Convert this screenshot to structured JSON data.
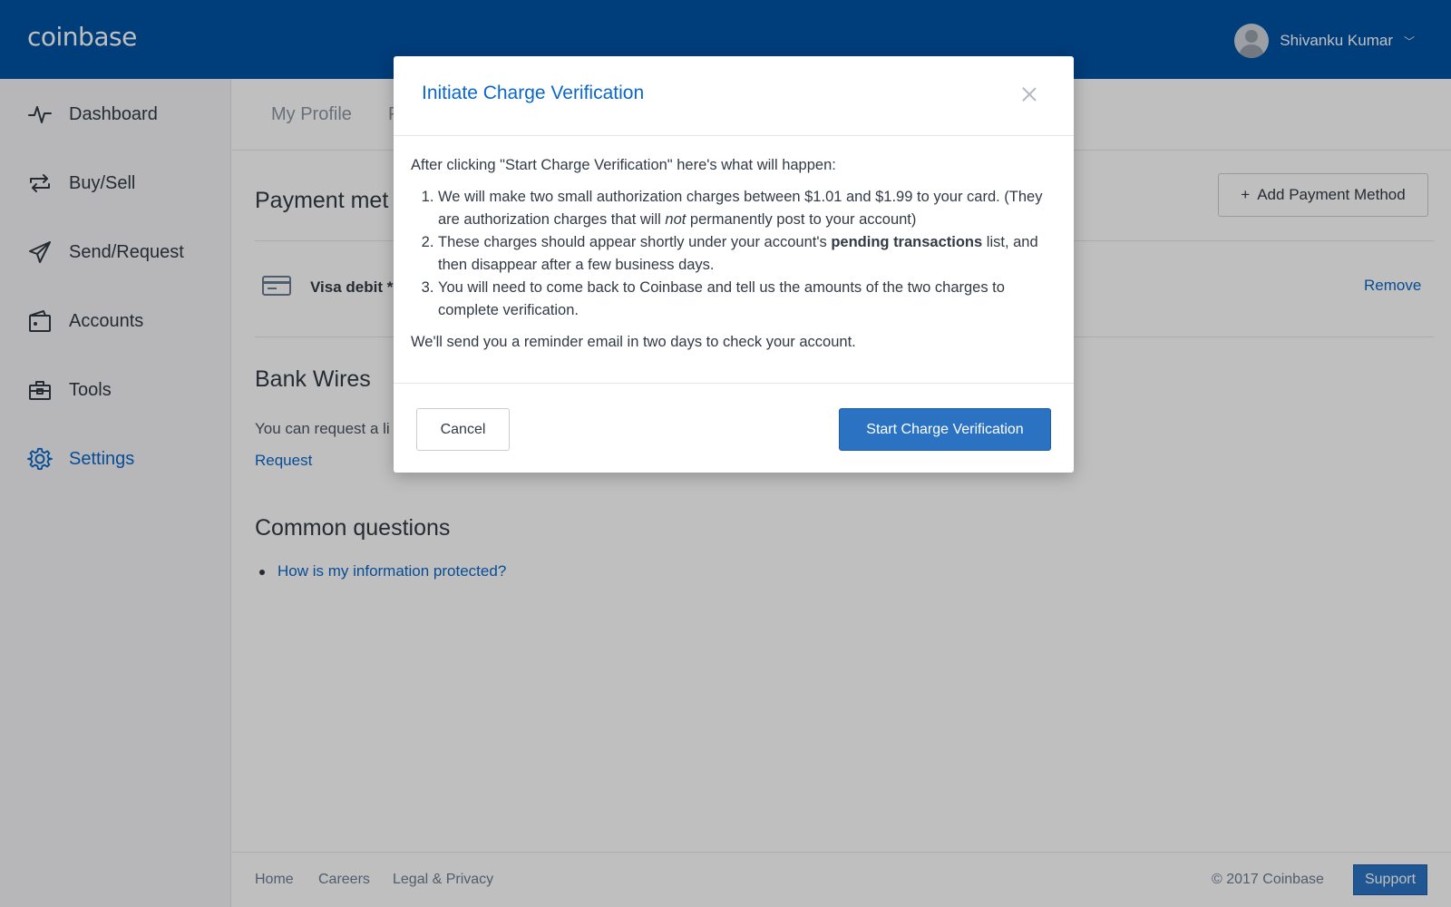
{
  "header": {
    "logo": "coinbase",
    "user_name": "Shivanku Kumar",
    "chevron": "﹀"
  },
  "sidebar": {
    "items": [
      {
        "label": "Dashboard",
        "icon": "pulse-icon"
      },
      {
        "label": "Buy/Sell",
        "icon": "exchange-icon"
      },
      {
        "label": "Send/Request",
        "icon": "paper-plane-icon"
      },
      {
        "label": "Accounts",
        "icon": "wallet-icon"
      },
      {
        "label": "Tools",
        "icon": "toolbox-icon"
      },
      {
        "label": "Settings",
        "icon": "gear-icon"
      }
    ],
    "active": "Settings"
  },
  "main": {
    "tabs": [
      "My Profile",
      "P"
    ],
    "payment_title": "Payment met",
    "add_payment_label": "Add Payment Method",
    "card_label": "Visa debit *",
    "remove_label": "Remove",
    "bank_wires_title": "Bank Wires",
    "bank_wires_text": "You can request a li",
    "request_label": "Request",
    "common_questions_title": "Common questions",
    "faq_link": "How is my information protected?"
  },
  "footer": {
    "links": [
      "Home",
      "Careers",
      "Legal & Privacy"
    ],
    "copyright": "© 2017 Coinbase",
    "support_label": "Support"
  },
  "modal": {
    "title": "Initiate Charge Verification",
    "intro": "After clicking \"Start Charge Verification\" here's what will happen:",
    "step1_a": "We will make two small authorization charges between $1.01 and $1.99 to your card. (They are authorization charges that will ",
    "step1_em": "not",
    "step1_b": " permanently post to your account)",
    "step2_a": "These charges should appear shortly under your account's ",
    "step2_strong": "pending transactions",
    "step2_b": " list, and then disappear after a few business days.",
    "step3": "You will need to come back to Coinbase and tell us the amounts of the two charges to complete verification.",
    "outro": "We'll send you a reminder email in two days to check your account.",
    "cancel_label": "Cancel",
    "start_label": "Start Charge Verification"
  }
}
